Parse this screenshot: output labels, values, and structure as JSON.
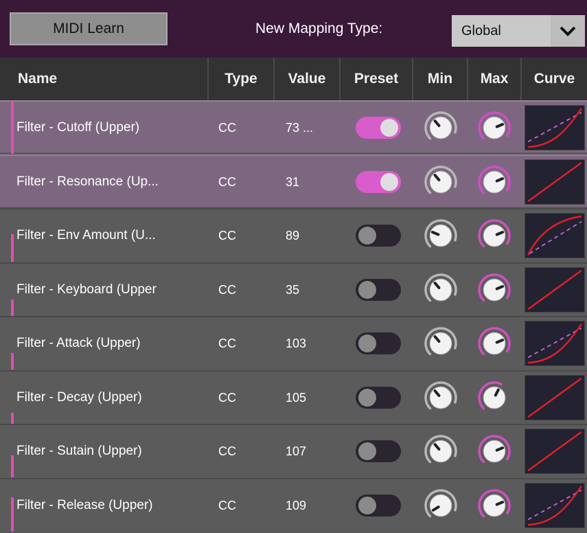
{
  "toolbar": {
    "midi_learn_label": "MIDI Learn",
    "mapping_type_label": "New Mapping Type:",
    "mapping_type_value": "Global"
  },
  "columns": {
    "name": "Name",
    "type": "Type",
    "value": "Value",
    "preset": "Preset",
    "min": "Min",
    "max": "Max",
    "curve": "Curve"
  },
  "colors": {
    "accent_pink": "#e04fb4",
    "selected_row": "#7d6780",
    "row": "#5b5b5b",
    "header": "#333333",
    "curve_line": "#e0202a",
    "curve_dash": "#c060d0"
  },
  "rows": [
    {
      "name": "Filter - Cutoff (Upper)",
      "type": "CC",
      "value": "73 ...",
      "preset": true,
      "selected": true,
      "min_level": 0.35,
      "max_level": 0.75,
      "max_arc": 0.95,
      "curve": "bend-dashed"
    },
    {
      "name": "Filter - Resonance (Up...",
      "type": "CC",
      "value": "31",
      "preset": true,
      "selected": true,
      "min_level": 0.35,
      "max_level": 0.75,
      "max_arc": 0.95,
      "curve": "linear"
    },
    {
      "name": "Filter - Env Amount (U...",
      "type": "CC",
      "value": "89",
      "preset": false,
      "selected": false,
      "min_level": 0.25,
      "max_level": 0.75,
      "max_arc": 0.95,
      "curve": "bulge-dashed"
    },
    {
      "name": "Filter - Keyboard (Upper",
      "type": "CC",
      "value": "35",
      "preset": false,
      "selected": false,
      "min_level": 0.35,
      "max_level": 0.75,
      "max_arc": 0.95,
      "curve": "linear"
    },
    {
      "name": "Filter - Attack (Upper)",
      "type": "CC",
      "value": "103",
      "preset": false,
      "selected": false,
      "min_level": 0.35,
      "max_level": 0.75,
      "max_arc": 0.95,
      "curve": "bend-dashed"
    },
    {
      "name": "Filter - Decay (Upper)",
      "type": "CC",
      "value": "105",
      "preset": false,
      "selected": false,
      "min_level": 0.35,
      "max_level": 0.6,
      "max_arc": 0.6,
      "curve": "linear"
    },
    {
      "name": "Filter - Sutain (Upper)",
      "type": "CC",
      "value": "107",
      "preset": false,
      "selected": false,
      "min_level": 0.35,
      "max_level": 0.75,
      "max_arc": 0.95,
      "curve": "linear"
    },
    {
      "name": "Filter - Release (Upper)",
      "type": "CC",
      "value": "109",
      "preset": false,
      "selected": false,
      "min_level": 0.05,
      "max_level": 0.75,
      "max_arc": 0.95,
      "curve": "bend-dashed"
    }
  ]
}
